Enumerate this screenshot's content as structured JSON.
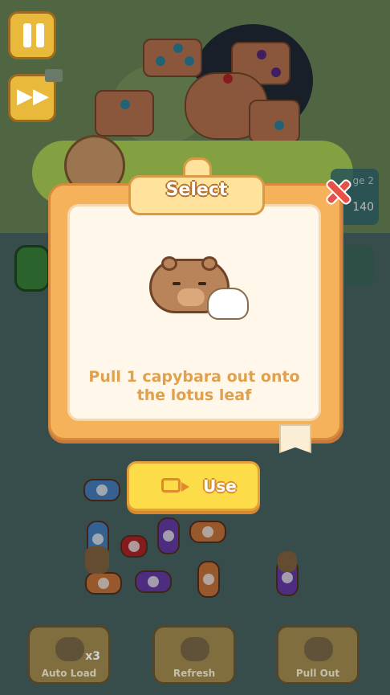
{
  "popup": {
    "title": "Select",
    "instruction": "Pull 1 capybara out onto the lotus leaf",
    "use_label": "Use"
  },
  "hud": {
    "level_text": "ge 2",
    "coins": "140"
  },
  "bottom_bar": {
    "auto_load": "Auto Load",
    "auto_load_count": "x3",
    "refresh": "Refresh",
    "pull_out": "Pull Out"
  },
  "icons": [
    "pause-icon",
    "fast-forward-icon",
    "video-icon",
    "close-icon",
    "capybara-icon",
    "hand-pointer-icon"
  ],
  "colors": {
    "popup_frame": "#f5b25b",
    "popup_inner": "#fff7ea",
    "instruction_text": "#e1a04c",
    "use_button": "#fddc4a",
    "close_x": "#e8514a"
  }
}
